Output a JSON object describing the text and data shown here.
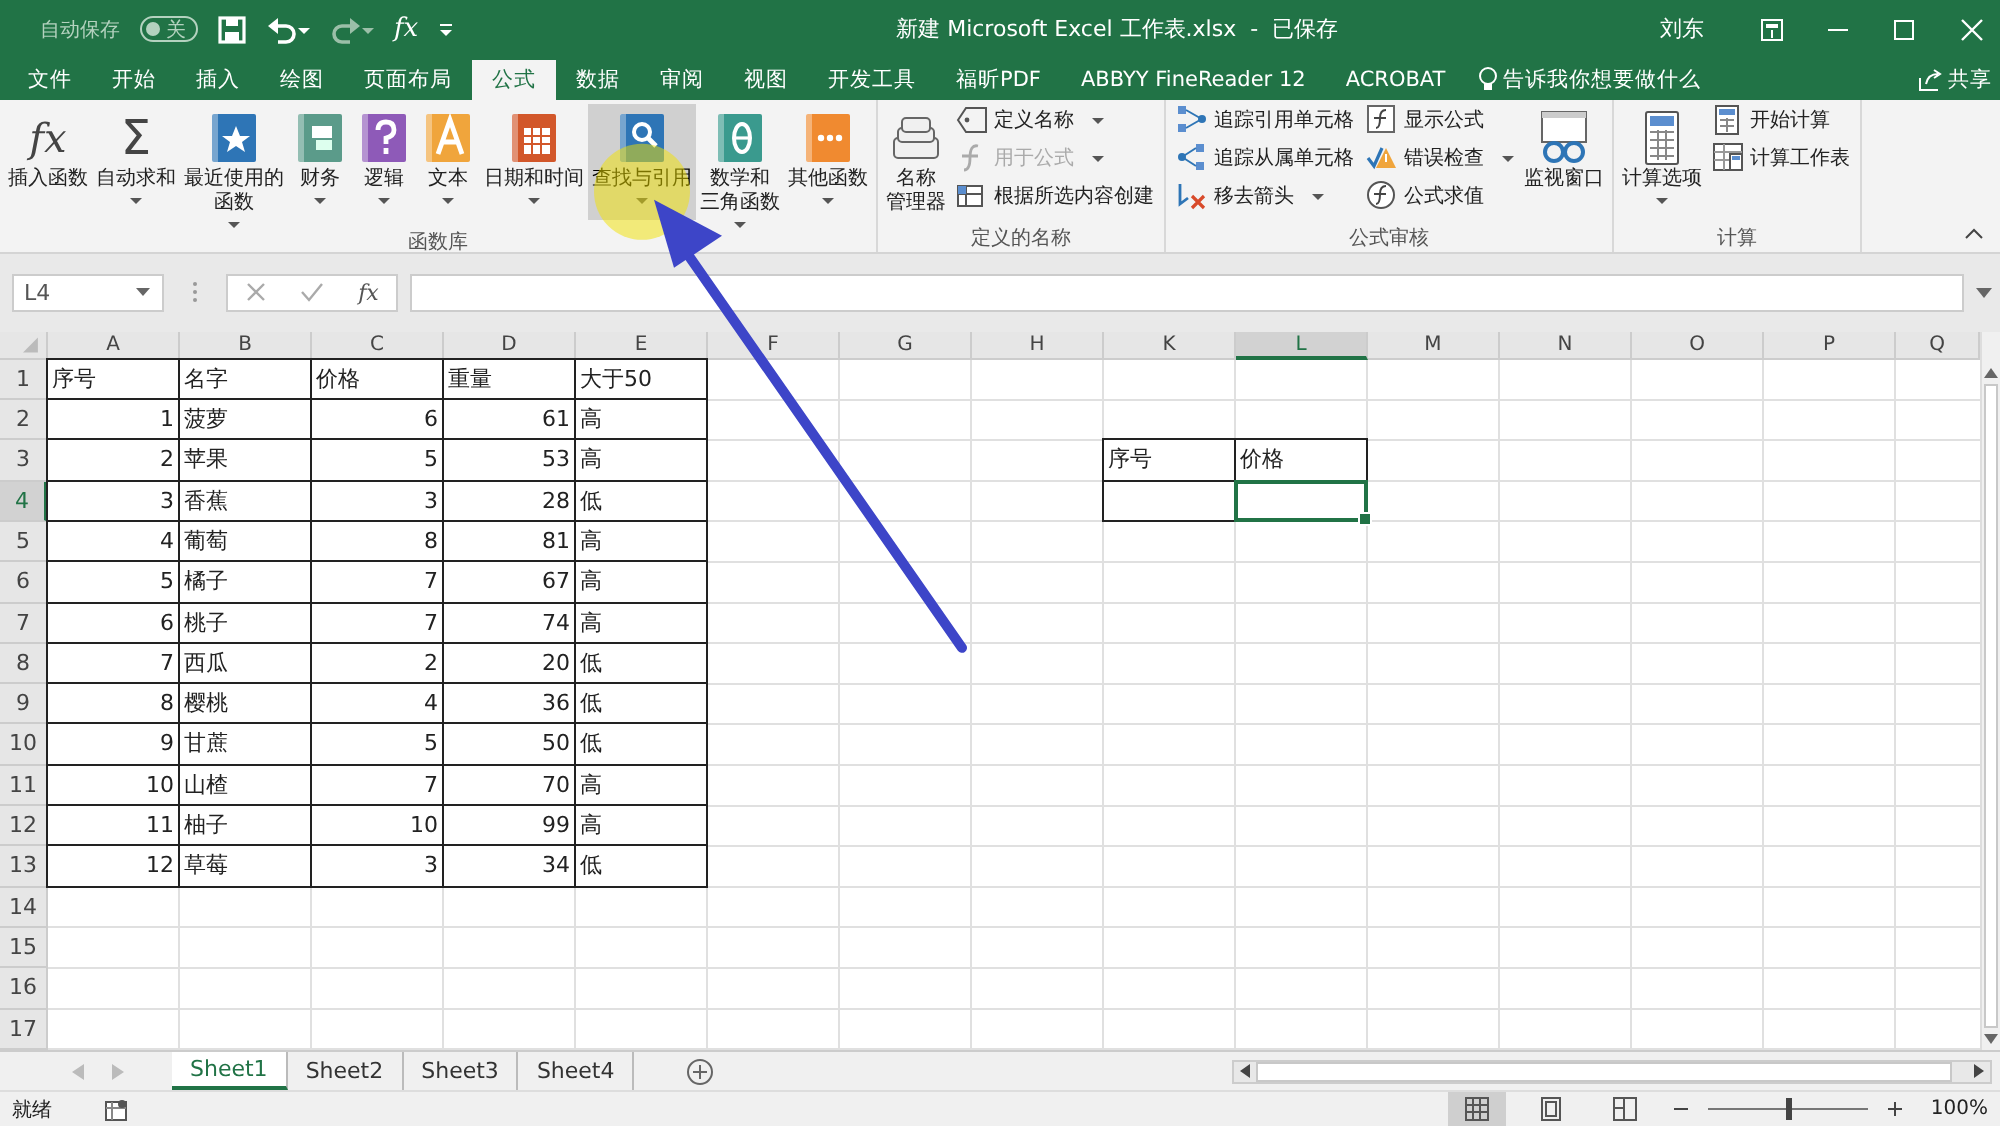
{
  "title_bar": {
    "autosave": {
      "label": "自动保存",
      "state": "关",
      "on": false
    },
    "quick_access_glyph": "fx",
    "title": "新建 Microsoft Excel 工作表.xlsx  -  已保存",
    "user": "刘东"
  },
  "tabs": [
    {
      "label": "文件",
      "selected": false
    },
    {
      "label": "开始",
      "selected": false
    },
    {
      "label": "插入",
      "selected": false
    },
    {
      "label": "绘图",
      "selected": false
    },
    {
      "label": "页面布局",
      "selected": false
    },
    {
      "label": "公式",
      "selected": true
    },
    {
      "label": "数据",
      "selected": false
    },
    {
      "label": "审阅",
      "selected": false
    },
    {
      "label": "视图",
      "selected": false
    },
    {
      "label": "开发工具",
      "selected": false
    },
    {
      "label": "福昕PDF",
      "selected": false
    },
    {
      "label": "ABBYY FineReader 12",
      "selected": false
    },
    {
      "label": "ACROBAT",
      "selected": false
    }
  ],
  "tell_me": "告诉我你想要做什么",
  "share": "共享",
  "ribbon": {
    "groups": [
      {
        "label": "函数库",
        "items": [
          {
            "kind": "large",
            "glyph": "fx",
            "label": "插入函数",
            "dropdown": false,
            "highlighted": false
          },
          {
            "kind": "large",
            "glyph": "Σ",
            "label": "自动求和",
            "dropdown": true,
            "highlighted": false
          },
          {
            "kind": "large",
            "label_lines": [
              "最近使用的",
              "函数"
            ],
            "dropdown": true,
            "highlighted": false
          },
          {
            "kind": "large",
            "label": "财务",
            "dropdown": true,
            "highlighted": false
          },
          {
            "kind": "large",
            "label": "逻辑",
            "dropdown": true,
            "highlighted": false
          },
          {
            "kind": "large",
            "label": "文本",
            "dropdown": true,
            "highlighted": false
          },
          {
            "kind": "large",
            "label": "日期和时间",
            "dropdown": true,
            "highlighted": false
          },
          {
            "kind": "large",
            "label": "查找与引用",
            "dropdown": true,
            "highlighted": true
          },
          {
            "kind": "large",
            "label_lines": [
              "数学和",
              "三角函数"
            ],
            "dropdown": true,
            "highlighted": false
          },
          {
            "kind": "large",
            "label": "其他函数",
            "dropdown": true,
            "highlighted": false
          }
        ]
      },
      {
        "label": "定义的名称",
        "items": [
          {
            "kind": "large",
            "label_lines": [
              "名称",
              "管理器"
            ],
            "dropdown": false,
            "highlighted": false
          },
          {
            "kind": "stack",
            "items": [
              {
                "label": "定义名称",
                "dropdown": true,
                "disabled": false
              },
              {
                "label": "用于公式",
                "dropdown": true,
                "disabled": true
              },
              {
                "label": "根据所选内容创建",
                "dropdown": false,
                "disabled": false
              }
            ]
          }
        ]
      },
      {
        "label": "公式审核",
        "items": [
          {
            "kind": "stack",
            "items": [
              {
                "label": "追踪引用单元格",
                "dropdown": false,
                "disabled": false
              },
              {
                "label": "追踪从属单元格",
                "dropdown": false,
                "disabled": false
              },
              {
                "label": "移去箭头",
                "dropdown": true,
                "disabled": false
              }
            ]
          },
          {
            "kind": "stack",
            "items": [
              {
                "label": "显示公式",
                "dropdown": false,
                "disabled": false
              },
              {
                "label": "错误检查",
                "dropdown": true,
                "disabled": false
              },
              {
                "label": "公式求值",
                "dropdown": false,
                "disabled": false
              }
            ]
          },
          {
            "kind": "large",
            "label": "监视窗口",
            "dropdown": false,
            "highlighted": false
          }
        ]
      },
      {
        "label": "计算",
        "items": [
          {
            "kind": "large",
            "label": "计算选项",
            "dropdown": true,
            "highlighted": false
          },
          {
            "kind": "stack",
            "items": [
              {
                "label": "开始计算",
                "dropdown": false,
                "disabled": false
              },
              {
                "label": "计算工作表",
                "dropdown": false,
                "disabled": false
              }
            ]
          }
        ]
      }
    ]
  },
  "formula_bar": {
    "name_box": "L4",
    "function_glyph": "fx"
  },
  "sheet": {
    "columns": [
      {
        "label": "A",
        "selected": false
      },
      {
        "label": "B",
        "selected": false
      },
      {
        "label": "C",
        "selected": false
      },
      {
        "label": "D",
        "selected": false
      },
      {
        "label": "E",
        "selected": false
      },
      {
        "label": "F",
        "selected": false
      },
      {
        "label": "G",
        "selected": false
      },
      {
        "label": "H",
        "selected": false
      },
      {
        "label": "K",
        "selected": false
      },
      {
        "label": "L",
        "selected": true
      },
      {
        "label": "M",
        "selected": false
      },
      {
        "label": "N",
        "selected": false
      },
      {
        "label": "O",
        "selected": false
      },
      {
        "label": "P",
        "selected": false
      },
      {
        "label": "Q",
        "selected": false
      }
    ],
    "rows": [
      {
        "label": "1",
        "selected": false,
        "cells": [
          {
            "text": "序号",
            "kind": "text",
            "bordered": true
          },
          {
            "text": "名字",
            "kind": "text",
            "bordered": true
          },
          {
            "text": "价格",
            "kind": "text",
            "bordered": true
          },
          {
            "text": "重量",
            "kind": "text",
            "bordered": true
          },
          {
            "text": "大于50",
            "kind": "text",
            "bordered": true
          }
        ]
      },
      {
        "label": "2",
        "selected": false,
        "cells": [
          {
            "text": "1",
            "kind": "number",
            "bordered": true
          },
          {
            "text": "菠萝",
            "kind": "text",
            "bordered": true
          },
          {
            "text": "6",
            "kind": "number",
            "bordered": true
          },
          {
            "text": "61",
            "kind": "number",
            "bordered": true
          },
          {
            "text": "高",
            "kind": "text",
            "bordered": true
          }
        ]
      },
      {
        "label": "3",
        "selected": false,
        "cells": [
          {
            "text": "2",
            "kind": "number",
            "bordered": true
          },
          {
            "text": "苹果",
            "kind": "text",
            "bordered": true
          },
          {
            "text": "5",
            "kind": "number",
            "bordered": true
          },
          {
            "text": "53",
            "kind": "number",
            "bordered": true
          },
          {
            "text": "高",
            "kind": "text",
            "bordered": true
          },
          null,
          null,
          null,
          {
            "text": "序号",
            "kind": "text",
            "bordered": true
          },
          {
            "text": "价格",
            "kind": "text",
            "bordered": true
          }
        ]
      },
      {
        "label": "4",
        "selected": true,
        "cells": [
          {
            "text": "3",
            "kind": "number",
            "bordered": true
          },
          {
            "text": "香蕉",
            "kind": "text",
            "bordered": true
          },
          {
            "text": "3",
            "kind": "number",
            "bordered": true
          },
          {
            "text": "28",
            "kind": "number",
            "bordered": true
          },
          {
            "text": "低",
            "kind": "text",
            "bordered": true
          },
          null,
          null,
          null,
          {
            "bordered": true,
            "selected": false
          },
          {
            "bordered": true,
            "selected": true
          }
        ]
      },
      {
        "label": "5",
        "selected": false,
        "cells": [
          {
            "text": "4",
            "kind": "number",
            "bordered": true
          },
          {
            "text": "葡萄",
            "kind": "text",
            "bordered": true
          },
          {
            "text": "8",
            "kind": "number",
            "bordered": true
          },
          {
            "text": "81",
            "kind": "number",
            "bordered": true
          },
          {
            "text": "高",
            "kind": "text",
            "bordered": true
          }
        ]
      },
      {
        "label": "6",
        "selected": false,
        "cells": [
          {
            "text": "5",
            "kind": "number",
            "bordered": true
          },
          {
            "text": "橘子",
            "kind": "text",
            "bordered": true
          },
          {
            "text": "7",
            "kind": "number",
            "bordered": true
          },
          {
            "text": "67",
            "kind": "number",
            "bordered": true
          },
          {
            "text": "高",
            "kind": "text",
            "bordered": true
          }
        ]
      },
      {
        "label": "7",
        "selected": false,
        "cells": [
          {
            "text": "6",
            "kind": "number",
            "bordered": true
          },
          {
            "text": "桃子",
            "kind": "text",
            "bordered": true
          },
          {
            "text": "7",
            "kind": "number",
            "bordered": true
          },
          {
            "text": "74",
            "kind": "number",
            "bordered": true
          },
          {
            "text": "高",
            "kind": "text",
            "bordered": true
          }
        ]
      },
      {
        "label": "8",
        "selected": false,
        "cells": [
          {
            "text": "7",
            "kind": "number",
            "bordered": true
          },
          {
            "text": "西瓜",
            "kind": "text",
            "bordered": true
          },
          {
            "text": "2",
            "kind": "number",
            "bordered": true
          },
          {
            "text": "20",
            "kind": "number",
            "bordered": true
          },
          {
            "text": "低",
            "kind": "text",
            "bordered": true
          }
        ]
      },
      {
        "label": "9",
        "selected": false,
        "cells": [
          {
            "text": "8",
            "kind": "number",
            "bordered": true
          },
          {
            "text": "樱桃",
            "kind": "text",
            "bordered": true
          },
          {
            "text": "4",
            "kind": "number",
            "bordered": true
          },
          {
            "text": "36",
            "kind": "number",
            "bordered": true
          },
          {
            "text": "低",
            "kind": "text",
            "bordered": true
          }
        ]
      },
      {
        "label": "10",
        "selected": false,
        "cells": [
          {
            "text": "9",
            "kind": "number",
            "bordered": true
          },
          {
            "text": "甘蔗",
            "kind": "text",
            "bordered": true
          },
          {
            "text": "5",
            "kind": "number",
            "bordered": true
          },
          {
            "text": "50",
            "kind": "number",
            "bordered": true
          },
          {
            "text": "低",
            "kind": "text",
            "bordered": true
          }
        ]
      },
      {
        "label": "11",
        "selected": false,
        "cells": [
          {
            "text": "10",
            "kind": "number",
            "bordered": true
          },
          {
            "text": "山楂",
            "kind": "text",
            "bordered": true
          },
          {
            "text": "7",
            "kind": "number",
            "bordered": true
          },
          {
            "text": "70",
            "kind": "number",
            "bordered": true
          },
          {
            "text": "高",
            "kind": "text",
            "bordered": true
          }
        ]
      },
      {
        "label": "12",
        "selected": false,
        "cells": [
          {
            "text": "11",
            "kind": "number",
            "bordered": true
          },
          {
            "text": "柚子",
            "kind": "text",
            "bordered": true
          },
          {
            "text": "10",
            "kind": "number",
            "bordered": true
          },
          {
            "text": "99",
            "kind": "number",
            "bordered": true
          },
          {
            "text": "高",
            "kind": "text",
            "bordered": true
          }
        ]
      },
      {
        "label": "13",
        "selected": false,
        "cells": [
          {
            "text": "12",
            "kind": "number",
            "bordered": true
          },
          {
            "text": "草莓",
            "kind": "text",
            "bordered": true
          },
          {
            "text": "3",
            "kind": "number",
            "bordered": true
          },
          {
            "text": "34",
            "kind": "number",
            "bordered": true
          },
          {
            "text": "低",
            "kind": "text",
            "bordered": true
          }
        ]
      },
      {
        "label": "14",
        "selected": false
      },
      {
        "label": "15",
        "selected": false
      },
      {
        "label": "16",
        "selected": false
      },
      {
        "label": "17",
        "selected": false
      }
    ]
  },
  "sheet_tabs": [
    {
      "label": "Sheet1",
      "selected": true
    },
    {
      "label": "Sheet2",
      "selected": false
    },
    {
      "label": "Sheet3",
      "selected": false
    },
    {
      "label": "Sheet4",
      "selected": false
    }
  ],
  "status_bar": {
    "status": "就绪",
    "views": [
      {
        "kind": "normal",
        "selected": true
      },
      {
        "kind": "page_layout",
        "selected": false
      },
      {
        "kind": "page_break",
        "selected": false
      }
    ],
    "zoom": {
      "level": 0.5,
      "reading": "100%"
    }
  },
  "annotations": [
    {
      "kind": "highlight"
    },
    {
      "kind": "arrow"
    }
  ]
}
